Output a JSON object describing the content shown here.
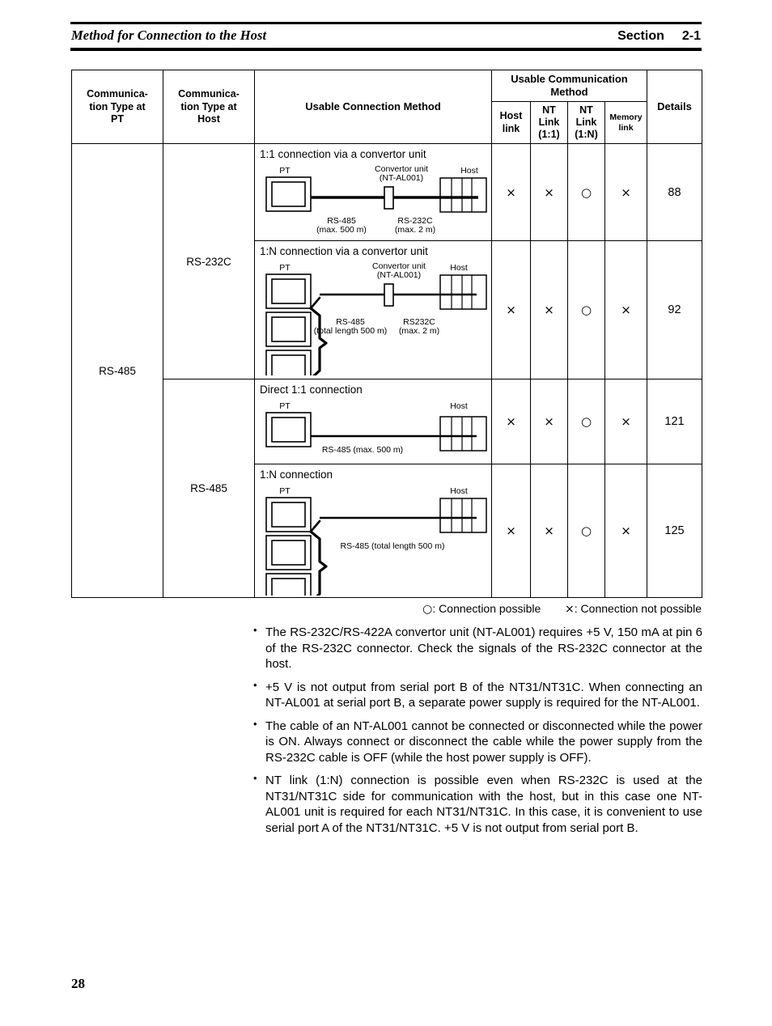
{
  "header": {
    "title": "Method for Connection to the Host",
    "section_label": "Section",
    "section_number": "2-1"
  },
  "table": {
    "columns": {
      "pt_type": "Communica-\ntion Type at\nPT",
      "host_type": "Communica-\ntion Type at\nHost",
      "connection_method": "Usable Connection Method",
      "group_header": "Usable Communication\nMethod",
      "host_link": "Host\nlink",
      "nt_link_11": "NT\nLink\n(1:1)",
      "nt_link_1n": "NT\nLink\n(1:N)",
      "memory_link": "Memory\nlink",
      "details": "Details"
    },
    "pt_type_value": "RS-485",
    "host_type_groups": [
      {
        "label": "RS-232C",
        "rows": 2
      },
      {
        "label": "RS-485",
        "rows": 2
      }
    ],
    "rows": [
      {
        "diagram_title": "1:1 connection via a convertor unit",
        "labels": {
          "pt": "PT",
          "host": "Host",
          "convertor": "Convertor unit",
          "convertor_model": "(NT-AL001)",
          "left_cable": "RS-485",
          "left_cable_len": "(max. 500 m)",
          "right_cable": "RS-232C",
          "right_cable_len": "(max. 2 m)"
        },
        "host_link": "×",
        "nt_link_11": "×",
        "nt_link_1n": "○",
        "memory_link": "×",
        "details": "88"
      },
      {
        "diagram_title": "1:N connection via a convertor unit",
        "labels": {
          "pt": "PT",
          "host": "Host",
          "convertor": "Convertor unit",
          "convertor_model": "(NT-AL001)",
          "left_cable": "RS-485",
          "left_cable_len": "(total length 500 m)",
          "right_cable": "RS232C",
          "right_cable_len": "(max. 2 m)"
        },
        "host_link": "×",
        "nt_link_11": "×",
        "nt_link_1n": "○",
        "memory_link": "×",
        "details": "92"
      },
      {
        "diagram_title": "Direct 1:1 connection",
        "labels": {
          "pt": "PT",
          "host": "Host",
          "cable": "RS-485 (max. 500 m)"
        },
        "host_link": "×",
        "nt_link_11": "×",
        "nt_link_1n": "○",
        "memory_link": "×",
        "details": "121"
      },
      {
        "diagram_title": "1:N connection",
        "labels": {
          "pt": "PT",
          "host": "Host",
          "cable": "RS-485 (total length 500 m)"
        },
        "host_link": "×",
        "nt_link_11": "×",
        "nt_link_1n": "○",
        "memory_link": "×",
        "details": "125"
      }
    ]
  },
  "legend": {
    "possible_symbol": "○",
    "possible_text": ": Connection possible",
    "not_possible_symbol": "×",
    "not_possible_text": ": Connection not possible"
  },
  "notes": {
    "bullet": "•",
    "items": [
      "The RS-232C/RS-422A convertor unit (NT-AL001) requires +5 V, 150 mA at pin 6 of the RS-232C connector. Check the signals of the RS-232C connector at the host.",
      "+5 V is not output from serial port B of the NT31/NT31C. When connecting an NT-AL001 at serial port B, a separate power supply is required for the NT-AL001.",
      "The cable of an NT-AL001 cannot be connected or disconnected while the power is ON. Always connect or disconnect the cable while the power supply from the RS-232C cable is OFF (while the host power supply is OFF).",
      "NT link (1:N) connection is possible even when RS-232C is used at the NT31/NT31C side for communication with the host, but in this case one NT-AL001 unit is required for each NT31/NT31C. In this case, it is convenient to use serial port A of the NT31/NT31C. +5 V is not output from serial port B."
    ]
  },
  "page_number": "28",
  "colors": {
    "ink": "#000000",
    "paper": "#ffffff"
  }
}
